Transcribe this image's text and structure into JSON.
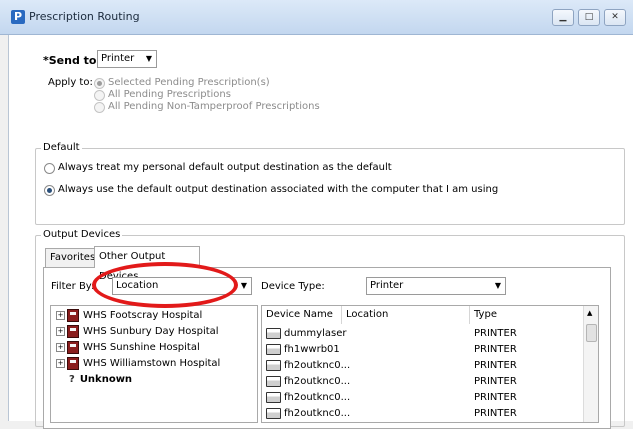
{
  "window": {
    "title": "Prescription Routing",
    "app_icon_letter": "P",
    "controls": [
      "minimize",
      "maximize",
      "close"
    ]
  },
  "send_to": {
    "label": "*Send to:",
    "value": "Printer"
  },
  "apply_to": {
    "label": "Apply to:",
    "options": [
      {
        "label": "Selected Pending Prescription(s)",
        "checked": true,
        "enabled": false
      },
      {
        "label": "All Pending Prescriptions",
        "checked": false,
        "enabled": false
      },
      {
        "label": "All Pending Non-Tamperproof Prescriptions",
        "checked": false,
        "enabled": false
      }
    ]
  },
  "default_group": {
    "title": "Default",
    "options": [
      {
        "label": "Always treat my personal default output destination as the default",
        "checked": false
      },
      {
        "label": "Always use the default output destination associated with the computer that I am using",
        "checked": true
      }
    ]
  },
  "output_devices": {
    "title": "Output Devices",
    "tabs": [
      {
        "label": "Favorites",
        "active": false
      },
      {
        "label": "Other Output Devices",
        "active": true
      }
    ],
    "filter_by": {
      "label": "Filter By:",
      "value": "Location"
    },
    "device_type": {
      "label": "Device Type:",
      "value": "Printer"
    },
    "locations": [
      {
        "label": "WHS Footscray Hospital",
        "bold": false
      },
      {
        "label": "WHS Sunbury Day Hospital",
        "bold": false
      },
      {
        "label": "WHS Sunshine Hospital",
        "bold": false
      },
      {
        "label": "WHS Williamstown Hospital",
        "bold": false
      },
      {
        "label": "Unknown",
        "bold": true
      }
    ],
    "device_list": {
      "columns": [
        "Device Name",
        "Location",
        "Type"
      ],
      "rows": [
        {
          "name": "dummylaser",
          "location": "",
          "type": "PRINTER"
        },
        {
          "name": "fh1wwrb01",
          "location": "",
          "type": "PRINTER"
        },
        {
          "name": "fh2outknc0...",
          "location": "",
          "type": "PRINTER"
        },
        {
          "name": "fh2outknc0...",
          "location": "",
          "type": "PRINTER"
        },
        {
          "name": "fh2outknc0...",
          "location": "",
          "type": "PRINTER"
        },
        {
          "name": "fh2outknc0...",
          "location": "",
          "type": "PRINTER"
        }
      ]
    }
  },
  "colors": {
    "annotation": "#e21a1a",
    "titlebar": "#c3d7ef"
  }
}
